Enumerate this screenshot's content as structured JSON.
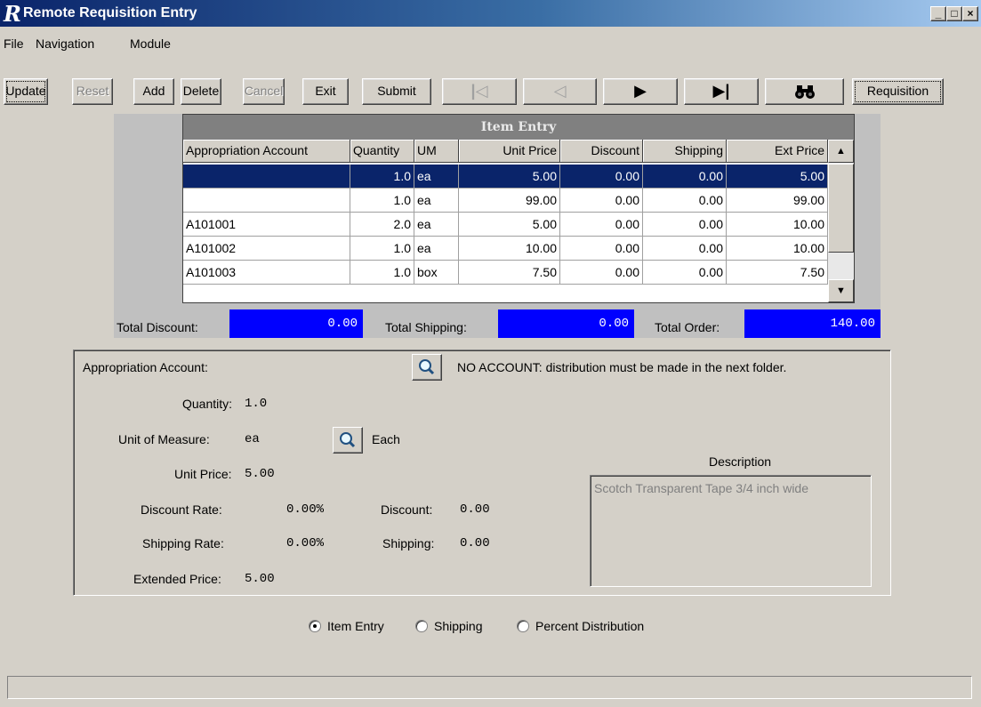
{
  "window": {
    "title": "Remote Requisition Entry",
    "logo": "R",
    "controls": [
      "_",
      "□",
      "×"
    ]
  },
  "menu": [
    {
      "label": "File"
    },
    {
      "label": "Navigation"
    },
    {
      "label": "Module"
    }
  ],
  "toolbar": {
    "update": "Update",
    "reset": "Reset",
    "add": "Add",
    "delete": "Delete",
    "cancel": "Cancel",
    "exit": "Exit",
    "submit": "Submit",
    "first": "|◁",
    "prev": "◁",
    "next": "▶",
    "last": "▶|",
    "find_icon": "binoculars-icon",
    "requisition": "Requisition"
  },
  "grid": {
    "title": "Item Entry",
    "columns": [
      "Appropriation Account",
      "Quantity",
      "UM",
      "Unit Price",
      "Discount",
      "Shipping",
      "Ext Price"
    ],
    "rows": [
      {
        "account": "",
        "quantity": "1.0",
        "um": "ea",
        "unit_price": "5.00",
        "discount": "0.00",
        "shipping": "0.00",
        "ext_price": "5.00"
      },
      {
        "account": "",
        "quantity": "1.0",
        "um": "ea",
        "unit_price": "99.00",
        "discount": "0.00",
        "shipping": "0.00",
        "ext_price": "99.00"
      },
      {
        "account": "A101001",
        "quantity": "2.0",
        "um": "ea",
        "unit_price": "5.00",
        "discount": "0.00",
        "shipping": "0.00",
        "ext_price": "10.00"
      },
      {
        "account": "A101002",
        "quantity": "1.0",
        "um": "ea",
        "unit_price": "10.00",
        "discount": "0.00",
        "shipping": "0.00",
        "ext_price": "10.00"
      },
      {
        "account": "A101003",
        "quantity": "1.0",
        "um": "box",
        "unit_price": "7.50",
        "discount": "0.00",
        "shipping": "0.00",
        "ext_price": "7.50"
      }
    ],
    "scroll_up": "▲",
    "scroll_down": "▼"
  },
  "totals": {
    "discount_label": "Total Discount:",
    "discount_value": "0.00",
    "shipping_label": "Total Shipping:",
    "shipping_value": "0.00",
    "order_label": "Total Order:",
    "order_value": "140.00"
  },
  "details": {
    "account_label": "Appropriation Account:",
    "account_message": "NO ACCOUNT: distribution must be made in the next folder.",
    "quantity_label": "Quantity:",
    "quantity_value": "1.0",
    "uom_label": "Unit of Measure:",
    "uom_value": "ea",
    "uom_desc": "Each",
    "unit_price_label": "Unit Price:",
    "unit_price_value": "5.00",
    "discount_rate_label": "Discount Rate:",
    "discount_rate_value": "0.00%",
    "discount_label": "Discount:",
    "discount_value": "0.00",
    "shipping_rate_label": "Shipping Rate:",
    "shipping_rate_value": "0.00%",
    "shipping_label": "Shipping:",
    "shipping_value": "0.00",
    "extended_price_label": "Extended Price:",
    "extended_price_value": "5.00",
    "description_label": "Description",
    "description_value": "Scotch Transparent Tape 3/4 inch wide"
  },
  "modes": [
    {
      "label": "Item Entry",
      "checked": true
    },
    {
      "label": "Shipping",
      "checked": false
    },
    {
      "label": "Percent Distribution",
      "checked": false
    }
  ],
  "status": ""
}
